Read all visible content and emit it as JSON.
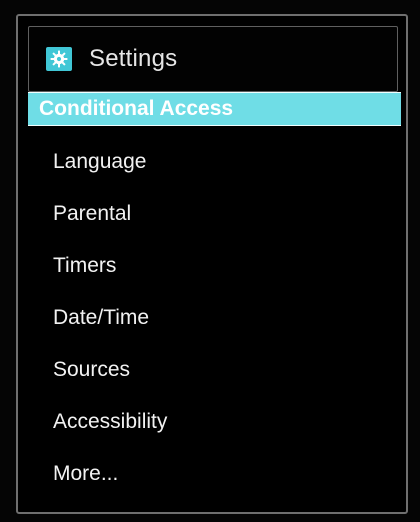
{
  "window": {
    "title": "Settings",
    "icon": "gear-icon",
    "accent_color": "#41c7d6",
    "selection_color": "#6fdde6"
  },
  "menu": {
    "items": [
      {
        "label": "Conditional Access",
        "selected": true
      },
      {
        "label": "Language",
        "selected": false
      },
      {
        "label": "Parental",
        "selected": false
      },
      {
        "label": "Timers",
        "selected": false
      },
      {
        "label": "Date/Time",
        "selected": false
      },
      {
        "label": "Sources",
        "selected": false
      },
      {
        "label": "Accessibility",
        "selected": false
      },
      {
        "label": "More...",
        "selected": false
      }
    ]
  }
}
